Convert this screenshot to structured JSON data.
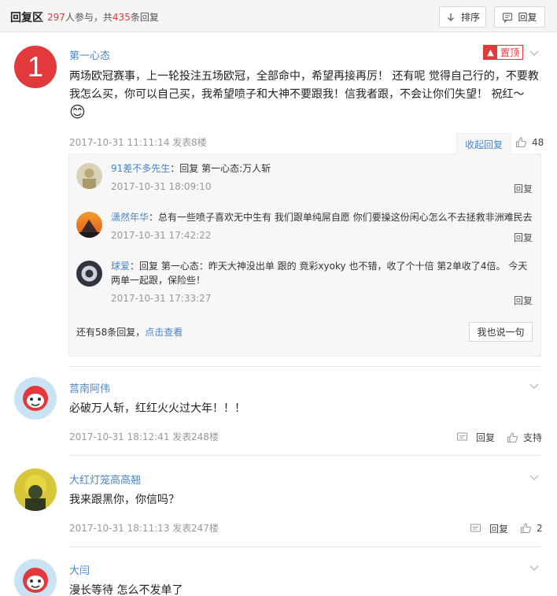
{
  "header": {
    "title": "回复区",
    "participants": "297",
    "participants_suffix": "人参与，共",
    "replies": "435",
    "replies_suffix": "条回复",
    "sort_label": "排序",
    "reply_label": "回复"
  },
  "comments": [
    {
      "user": "第一心态",
      "rank_badge": "1",
      "pinned_label": "置顶",
      "text": "两场欧冠赛事，上一轮投注五场欧冠，全部命中，希望再接再厉！ 还有呢 觉得自己行的，不要教我怎么买，你可以自己买，我希望喷子和大神不要跟我！信我者跟，不会让你们失望！ 祝红～",
      "emoji": "😊",
      "time": "2017-10-31 11:11:14 发表",
      "floor": "8楼",
      "collapse_label": "收起回复",
      "likes": "48",
      "replies": [
        {
          "user": "91差不多先生",
          "text": "：回复 第一心态:万人斩",
          "time": "2017-10-31 18:09:10",
          "reply_label": "回复"
        },
        {
          "user": "潇然年华",
          "text": "：总有一些喷子喜欢无中生有 我们跟单纯屌自愿 你们要操这份闲心怎么不去拯救非洲难民去",
          "time": "2017-10-31 17:42:22",
          "reply_label": "回复"
        },
        {
          "user": "球爱",
          "text": "：回复 第一心态：昨天大神没出单 跟的 竟彩xyoky 也不错，收了个十倍 第2单收了4倍。 今天两单一起跟，保险些！",
          "time": "2017-10-31 17:33:27",
          "reply_label": "回复"
        }
      ],
      "more_prefix": "还有58条回复，",
      "more_link": "点击查看",
      "say_label": "我也说一句"
    },
    {
      "user": "莒南阿伟",
      "text": "必破万人斩，红红火火过大年！！！",
      "time": "2017-10-31 18:12:41 发表",
      "floor": "248楼",
      "reply_label": "回复",
      "support_label": "支持"
    },
    {
      "user": "大红灯笼高高翘",
      "text": "我来跟黑你，你信吗？",
      "time": "2017-10-31 18:11:13 发表",
      "floor": "247楼",
      "reply_label": "回复",
      "likes": "2"
    },
    {
      "user": "大闫",
      "text": "漫长等待 怎么不发单了"
    }
  ],
  "colors": {
    "accent_red": "#e4393c",
    "link_blue": "#4a86c5"
  }
}
